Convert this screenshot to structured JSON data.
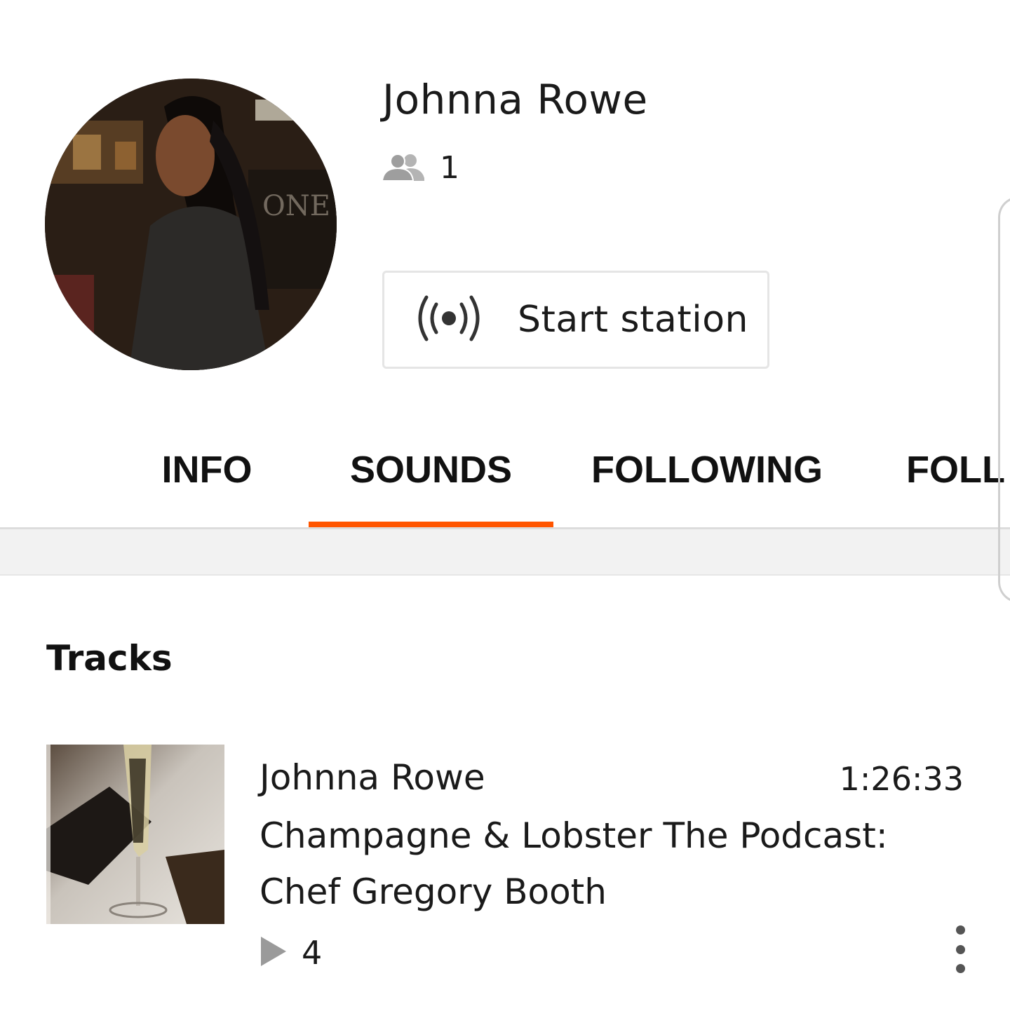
{
  "profile": {
    "name": "Johnna Rowe",
    "followers_count": "1",
    "followers_icon": "users-icon",
    "avatar_icon": "profile-photo"
  },
  "station_button": {
    "label": "Start station",
    "icon": "broadcast-icon"
  },
  "tabs": [
    {
      "label": "INFO",
      "active": false
    },
    {
      "label": "SOUNDS",
      "active": true
    },
    {
      "label": "FOLLOWING",
      "active": false
    },
    {
      "label": "FOLL",
      "active": false
    }
  ],
  "colors": {
    "accent": "#ff5500",
    "text": "#1a1a1a",
    "divider": "#dcdcdc",
    "band": "#f2f2f2"
  },
  "tracks_section": {
    "title": "Tracks",
    "items": [
      {
        "user": "Johnna Rowe",
        "title": "Champagne & Lobster The Podcast: Chef Gregory Booth",
        "duration": "1:26:33",
        "plays": "4",
        "play_icon": "play-icon",
        "more_icon": "more-vertical-icon"
      }
    ]
  }
}
